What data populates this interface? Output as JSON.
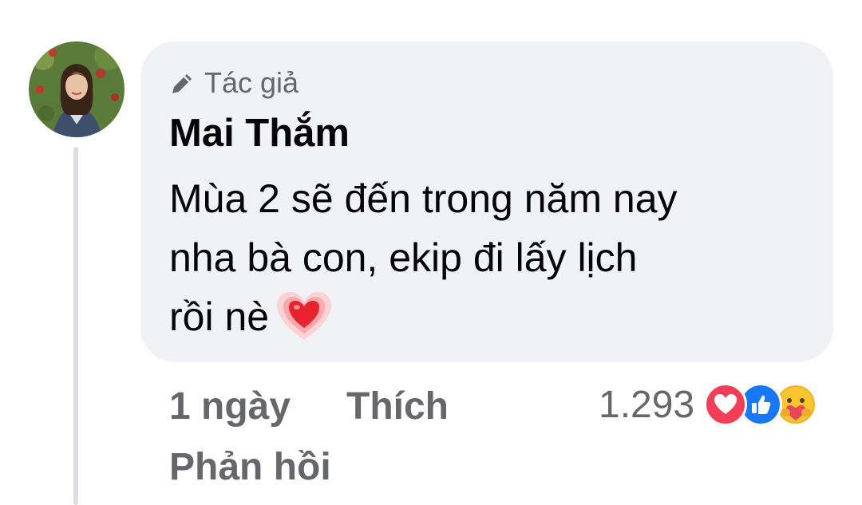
{
  "comment": {
    "author_badge": "Tác giả",
    "author_name": "Mai Thắm",
    "text_lines": [
      "Mùa 2 sẽ đến trong năm nay",
      "nha bà con, ekip đi lấy lịch",
      "rồi nè"
    ],
    "inline_emoji": "heart-emoji",
    "time": "1 ngày",
    "like_label": "Thích",
    "reply_label": "Phản hồi",
    "reaction_count": "1.293",
    "reactions": [
      "love",
      "like",
      "care"
    ]
  },
  "colors": {
    "bubble_bg": "#f0f2f5",
    "secondary_text": "#65676b",
    "primary_text": "#050505",
    "love": "#f33e58",
    "like": "#1877f2",
    "care": "#f7b125"
  }
}
